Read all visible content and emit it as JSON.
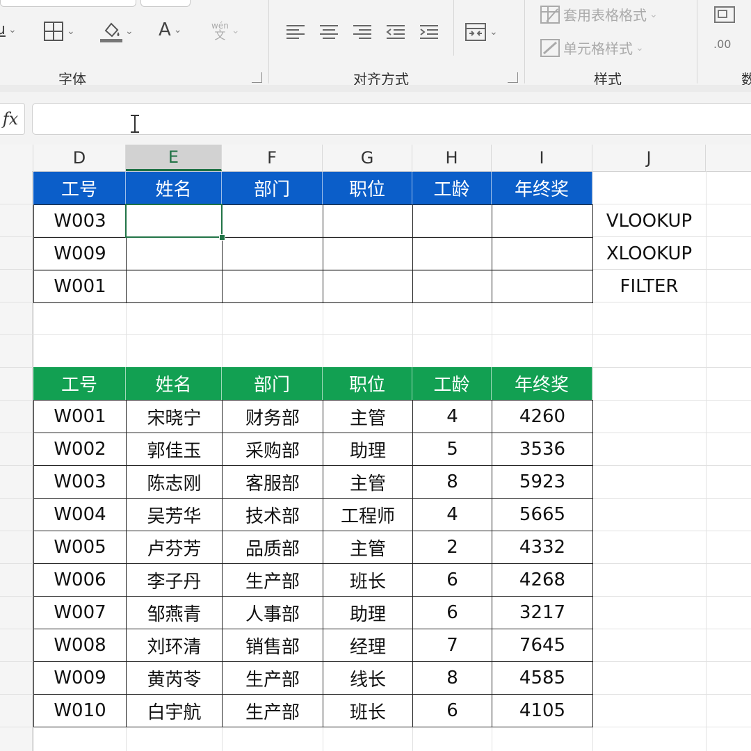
{
  "ribbon": {
    "groups": [
      {
        "key": "font",
        "label": "字体"
      },
      {
        "key": "align",
        "label": "对齐方式"
      },
      {
        "key": "style",
        "label": "样式"
      },
      {
        "key": "number",
        "label": "数"
      }
    ],
    "font_buttons": {
      "font_color_glyph": "A",
      "phonetic_top": "wén",
      "phonetic_bottom": "文"
    },
    "style_buttons": {
      "table_format": "套用表格格式",
      "cell_style": "单元格样式"
    },
    "number_buttons": {
      "decimal_label": ".00"
    }
  },
  "formula_bar": {
    "fx_label": "fx",
    "value": ""
  },
  "columns": [
    {
      "key": "D",
      "label": "D"
    },
    {
      "key": "E",
      "label": "E",
      "selected": true
    },
    {
      "key": "F",
      "label": "F"
    },
    {
      "key": "G",
      "label": "G"
    },
    {
      "key": "H",
      "label": "H"
    },
    {
      "key": "I",
      "label": "I"
    },
    {
      "key": "J",
      "label": "J"
    }
  ],
  "lookup_table": {
    "headers": [
      "工号",
      "姓名",
      "部门",
      "职位",
      "工龄",
      "年终奖"
    ],
    "rows": [
      [
        "W003",
        "",
        "",
        "",
        "",
        ""
      ],
      [
        "W009",
        "",
        "",
        "",
        "",
        ""
      ],
      [
        "W001",
        "",
        "",
        "",
        "",
        ""
      ]
    ],
    "side_labels": [
      "VLOOKUP",
      "XLOOKUP",
      "FILTER"
    ],
    "header_color": "#0b5ec9"
  },
  "source_table": {
    "headers": [
      "工号",
      "姓名",
      "部门",
      "职位",
      "工龄",
      "年终奖"
    ],
    "rows": [
      [
        "W001",
        "宋晓宁",
        "财务部",
        "主管",
        "4",
        "4260"
      ],
      [
        "W002",
        "郭佳玉",
        "采购部",
        "助理",
        "5",
        "3536"
      ],
      [
        "W003",
        "陈志刚",
        "客服部",
        "主管",
        "8",
        "5923"
      ],
      [
        "W004",
        "吴芳华",
        "技术部",
        "工程师",
        "4",
        "5665"
      ],
      [
        "W005",
        "卢芬芳",
        "品质部",
        "主管",
        "2",
        "4332"
      ],
      [
        "W006",
        "李子丹",
        "生产部",
        "班长",
        "6",
        "4268"
      ],
      [
        "W007",
        "邹燕青",
        "人事部",
        "助理",
        "6",
        "3217"
      ],
      [
        "W008",
        "刘环清",
        "销售部",
        "经理",
        "7",
        "7645"
      ],
      [
        "W009",
        "黄芮苓",
        "生产部",
        "线长",
        "8",
        "4585"
      ],
      [
        "W010",
        "白宇航",
        "生产部",
        "班长",
        "6",
        "4105"
      ]
    ],
    "header_color": "#12a052"
  },
  "selection": {
    "cell": "E",
    "accent": "#217346"
  }
}
